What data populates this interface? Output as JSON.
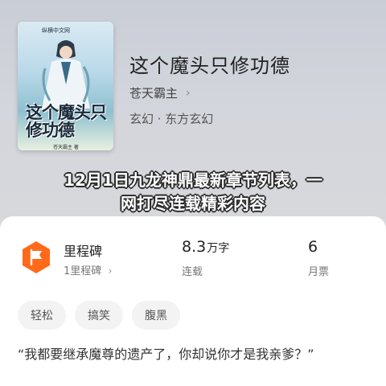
{
  "book": {
    "cover_publisher": "纵横中文网",
    "cover_title": "这个魔头只修功德",
    "cover_author": "苍天霸主 著",
    "title": "这个魔头只修功德",
    "author": "苍天霸主",
    "author_chevron": "›",
    "genre": "玄幻 · 东方玄幻"
  },
  "overlay": {
    "line1": "12月1日九龙神鼎最新章节列表，一",
    "line2": "网打尽连载精彩内容"
  },
  "stats": {
    "milestone_title": "里程碑",
    "milestone_sub": "1里程碑",
    "milestone_sub_chevron": "›",
    "words_value": "8.3",
    "words_unit": "万字",
    "words_label": "连载",
    "votes_value": "6",
    "votes_label": "月票"
  },
  "tags": [
    "轻松",
    "搞笑",
    "腹黑"
  ],
  "quote": "“我都要继承魔尊的遗产了，你却说你才是我亲爹？”",
  "colors": {
    "badge_orange": "#ff6a1a",
    "header_bg": "#d3d6dc"
  },
  "icons": {
    "badge": "flag-icon",
    "author_link": "chevron-right-icon"
  }
}
